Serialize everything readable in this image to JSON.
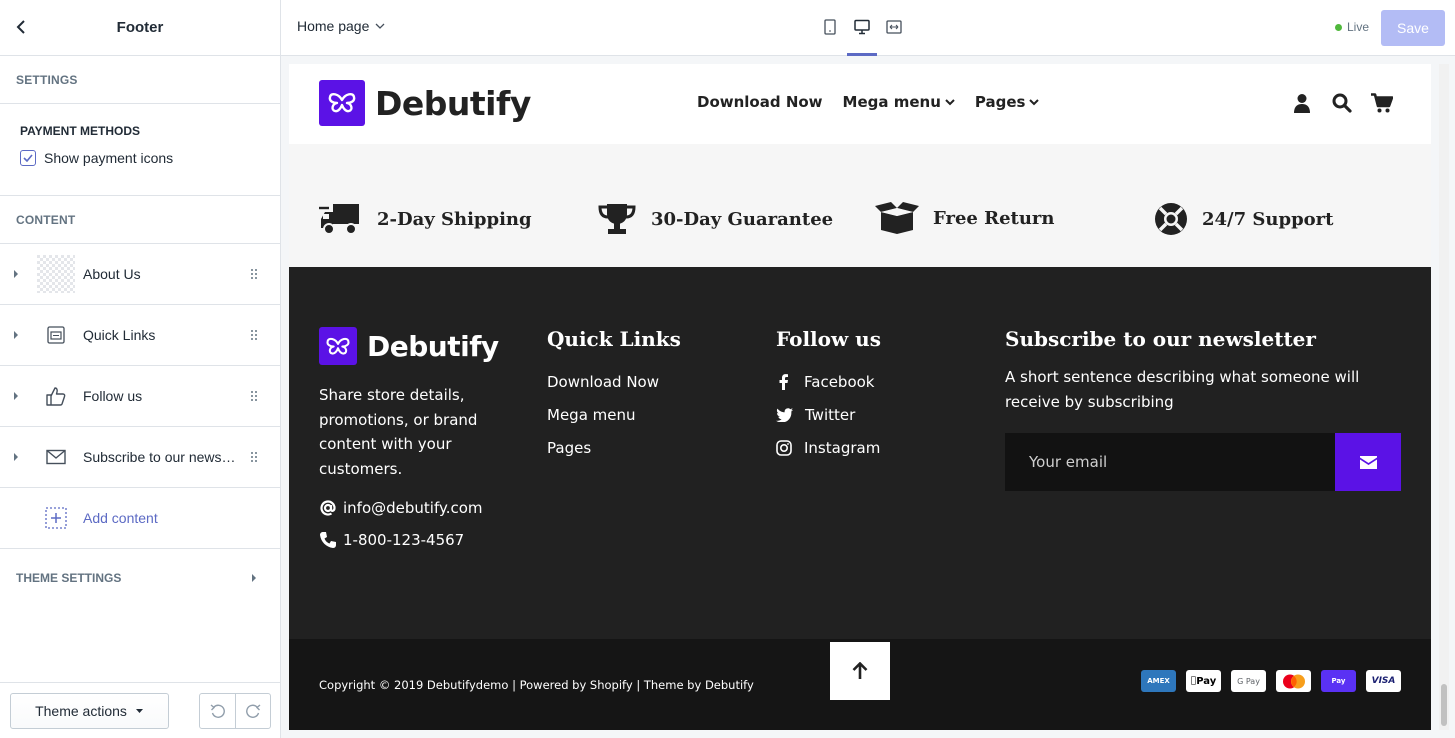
{
  "sidebar": {
    "title": "Footer",
    "settings_label": "SETTINGS",
    "payment_heading": "PAYMENT METHODS",
    "show_payment_label": "Show payment icons",
    "show_payment_checked": true,
    "content_label": "CONTENT",
    "blocks": [
      {
        "label": "About Us",
        "icon": "image-placeholder-icon"
      },
      {
        "label": "Quick Links",
        "icon": "link-list-icon"
      },
      {
        "label": "Follow us",
        "icon": "thumbs-up-icon"
      },
      {
        "label": "Subscribe to our news…",
        "icon": "envelope-icon"
      }
    ],
    "add_content_label": "Add content",
    "theme_settings_label": "THEME SETTINGS",
    "theme_actions_label": "Theme actions"
  },
  "topbar": {
    "page_label": "Home page",
    "live_label": "Live",
    "save_label": "Save",
    "accent": "#5c6ac4"
  },
  "site": {
    "brand": "Debutify",
    "brand_color": "#5b12e6",
    "nav": [
      "Download Now",
      "Mega menu",
      "Pages"
    ],
    "features": [
      "2-Day Shipping",
      "30-Day Guarantee",
      "Free Return",
      "24/7 Support"
    ],
    "footer": {
      "about_text": "Share store details, promotions, or brand content with your customers.",
      "email": "info@debutify.com",
      "phone": "1-800-123-4567",
      "quick_links_title": "Quick Links",
      "quick_links": [
        "Download Now",
        "Mega menu",
        "Pages"
      ],
      "follow_title": "Follow us",
      "social": [
        "Facebook",
        "Twitter",
        "Instagram"
      ],
      "newsletter_title": "Subscribe to our newsletter",
      "newsletter_desc": "A short sentence describing what someone will receive by subscribing",
      "email_placeholder": "Your email",
      "copyright": "Copyright © 2019 Debutifydemo | Powered by Shopify | Theme by Debutify",
      "payments": [
        "AMEX",
        "Pay",
        "G Pay",
        "Mastercard",
        "Pay",
        "VISA"
      ]
    }
  }
}
